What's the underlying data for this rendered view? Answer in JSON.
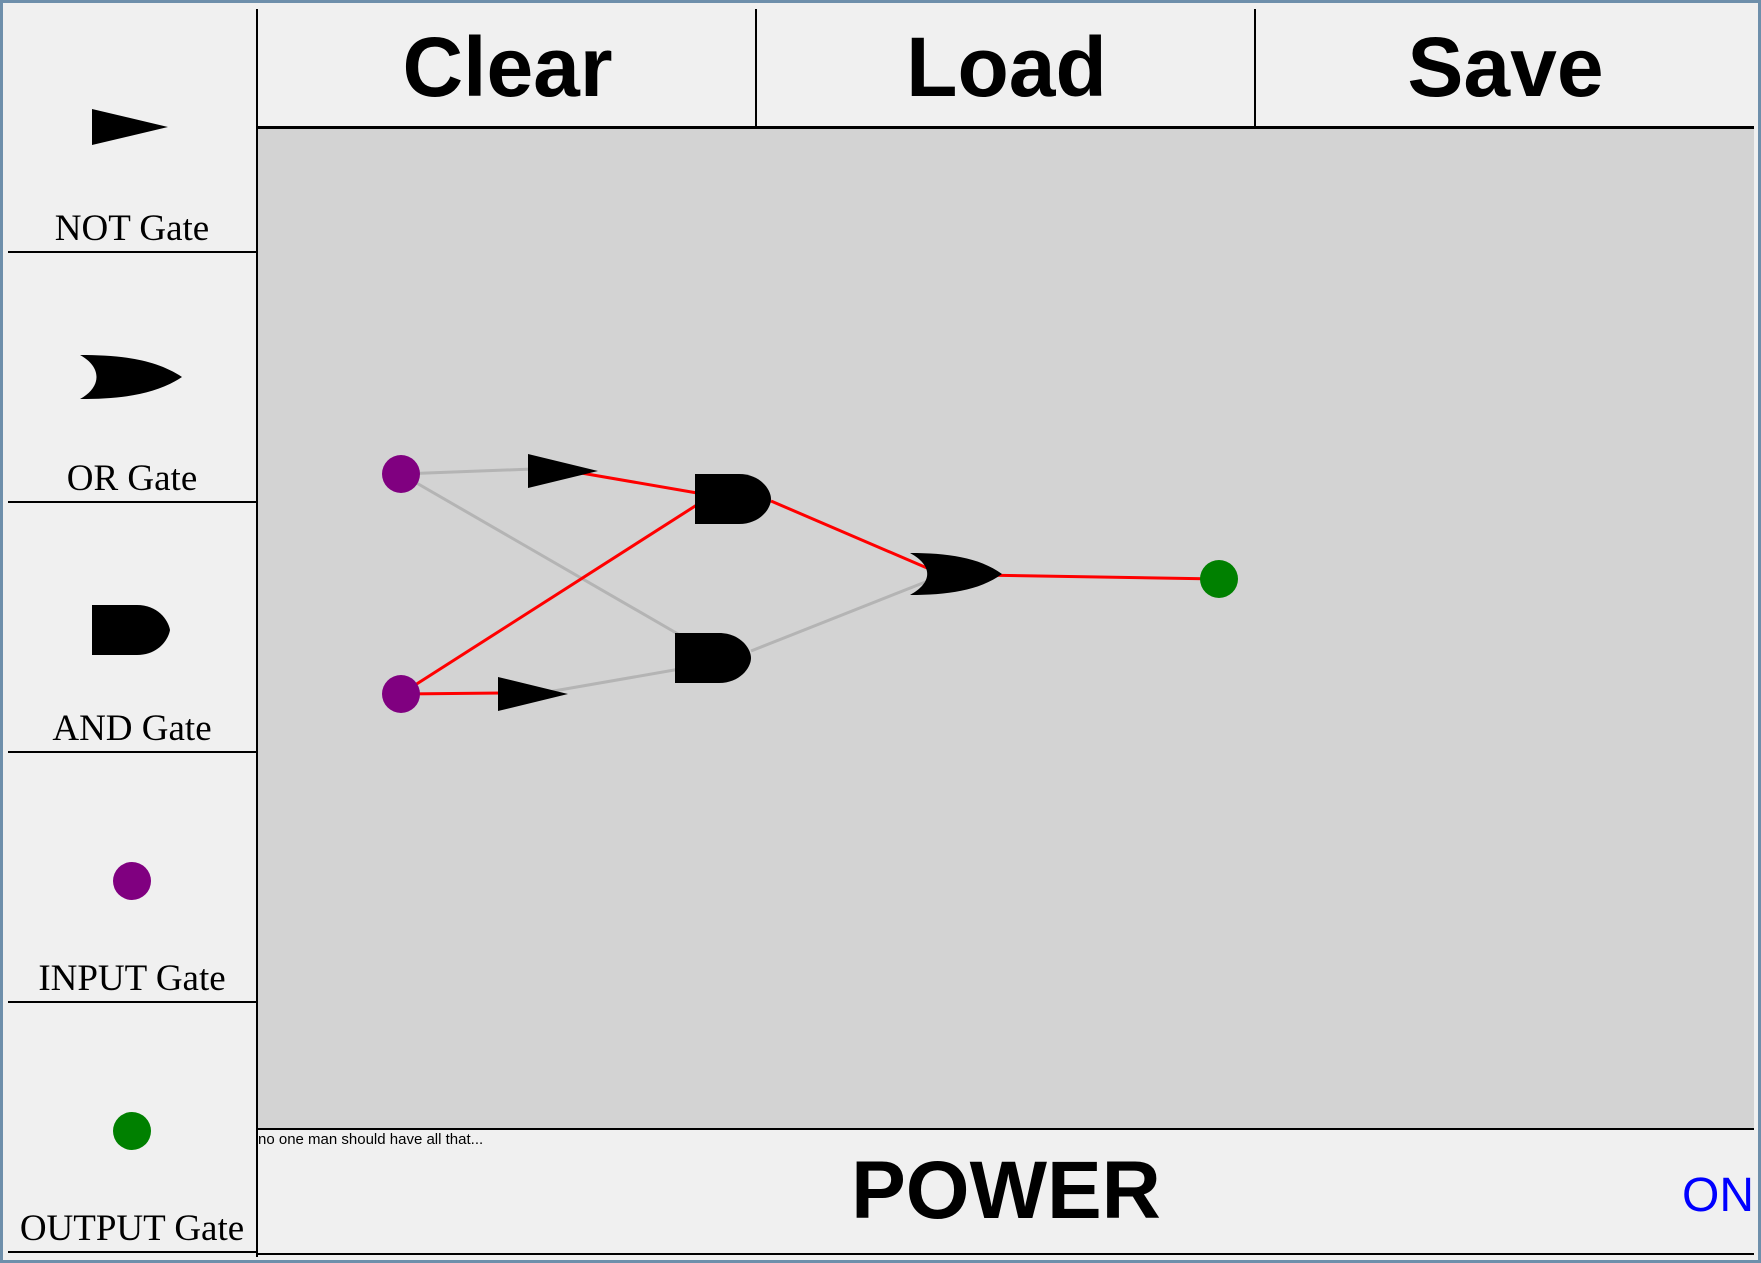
{
  "palette": {
    "items": [
      {
        "label": "NOT Gate",
        "icon": "not-gate-icon"
      },
      {
        "label": "OR Gate",
        "icon": "or-gate-icon"
      },
      {
        "label": "AND Gate",
        "icon": "and-gate-icon"
      },
      {
        "label": "INPUT Gate",
        "icon": "input-node-icon"
      },
      {
        "label": "OUTPUT Gate",
        "icon": "output-node-icon"
      }
    ]
  },
  "toolbar": {
    "clear_label": "Clear",
    "load_label": "Load",
    "save_label": "Save"
  },
  "canvas": {
    "background_color": "#d3d3d3",
    "colors": {
      "wire_active": "#ff0000",
      "wire_inactive": "#b4b4b4",
      "gate": "#000000",
      "input_node": "#800080",
      "output_node": "#008000"
    },
    "components": [
      {
        "id": "in1",
        "type": "input"
      },
      {
        "id": "in2",
        "type": "input"
      },
      {
        "id": "not1",
        "type": "not"
      },
      {
        "id": "not2",
        "type": "not"
      },
      {
        "id": "and1",
        "type": "and"
      },
      {
        "id": "and2",
        "type": "and"
      },
      {
        "id": "or1",
        "type": "or"
      },
      {
        "id": "out1",
        "type": "output"
      }
    ],
    "wires": [
      {
        "from": "in1",
        "to": "not1",
        "active": false
      },
      {
        "from": "in1",
        "to": "and2",
        "active": false
      },
      {
        "from": "in2",
        "to": "not2",
        "active": true
      },
      {
        "from": "in2",
        "to": "and1",
        "active": true
      },
      {
        "from": "not1",
        "to": "and1",
        "active": true
      },
      {
        "from": "not2",
        "to": "and2",
        "active": false
      },
      {
        "from": "and1",
        "to": "or1",
        "active": true
      },
      {
        "from": "and2",
        "to": "or1",
        "active": false
      },
      {
        "from": "or1",
        "to": "out1",
        "active": true
      }
    ]
  },
  "status": {
    "text": "no one man should have all that...",
    "power_label": "POWER",
    "power_state": "ON",
    "power_state_color": "#0000ff"
  }
}
